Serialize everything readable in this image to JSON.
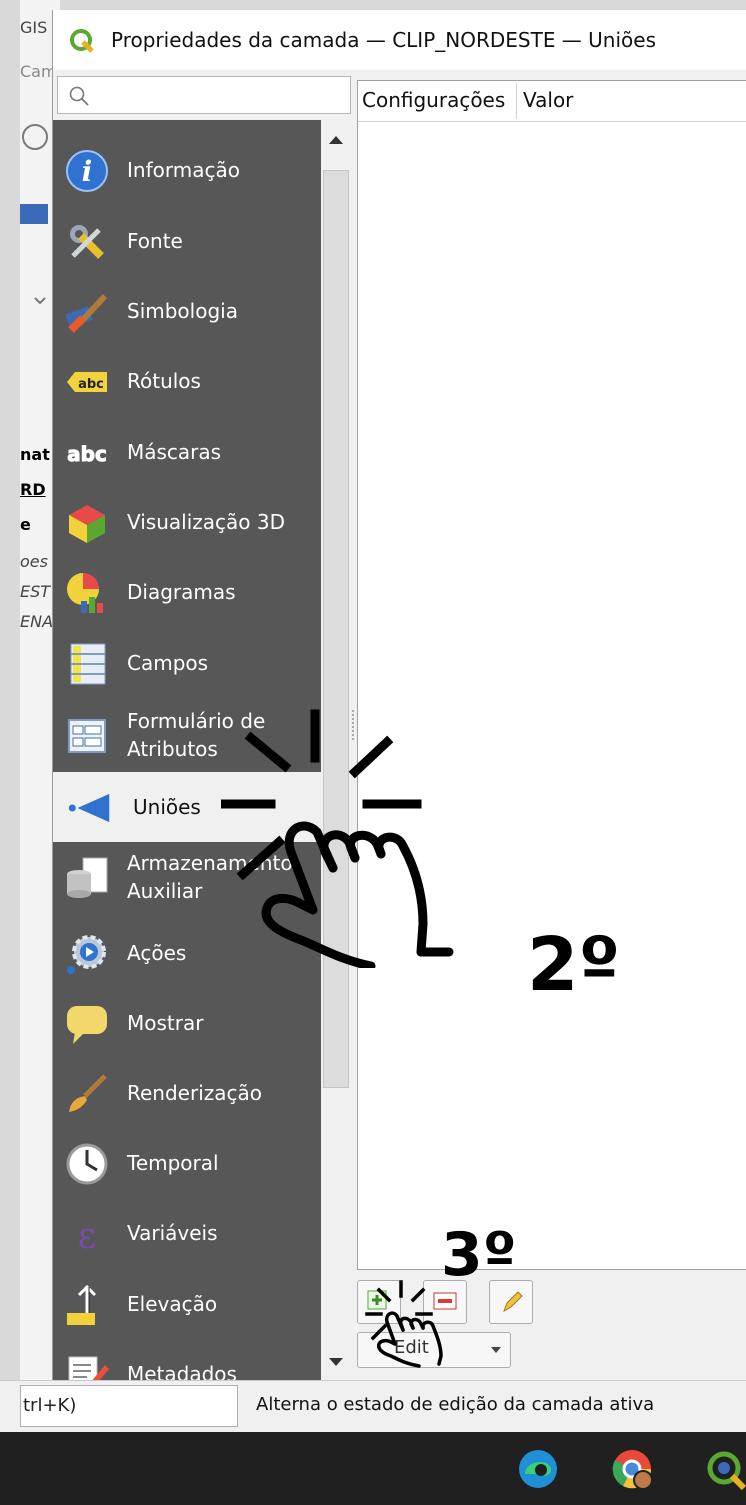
{
  "background_window": {
    "fragments": [
      "GIS",
      "Cam",
      "nat",
      "RD",
      "e",
      "oes",
      "EST",
      "ENA"
    ]
  },
  "dialog": {
    "title": "Propriedades da camada — CLIP_NORDESTE — Uniões",
    "search_placeholder": ""
  },
  "sidebar": {
    "items": [
      {
        "label": "Informação",
        "icon": "info-icon"
      },
      {
        "label": "Fonte",
        "icon": "source-tools-icon"
      },
      {
        "label": "Simbologia",
        "icon": "symbology-brush-icon"
      },
      {
        "label": "Rótulos",
        "icon": "labels-abc-icon"
      },
      {
        "label": "Máscaras",
        "icon": "masks-abc-icon"
      },
      {
        "label": "Visualização 3D",
        "icon": "cube-3d-icon"
      },
      {
        "label": "Diagramas",
        "icon": "diagrams-icon"
      },
      {
        "label": "Campos",
        "icon": "fields-icon"
      },
      {
        "label": "Formulário de\nAtributos",
        "icon": "attribute-form-icon"
      },
      {
        "label": "Uniões",
        "icon": "joins-icon",
        "selected": true
      },
      {
        "label": "Armazenamento\nAuxiliar",
        "icon": "auxiliary-storage-icon"
      },
      {
        "label": "Ações",
        "icon": "actions-gear-icon"
      },
      {
        "label": "Mostrar",
        "icon": "display-speech-icon"
      },
      {
        "label": "Renderização",
        "icon": "rendering-brush-icon"
      },
      {
        "label": "Temporal",
        "icon": "clock-icon"
      },
      {
        "label": "Variáveis",
        "icon": "epsilon-icon"
      },
      {
        "label": "Elevação",
        "icon": "elevation-icon"
      },
      {
        "label": "Metadados",
        "icon": "metadata-icon"
      }
    ]
  },
  "table": {
    "headers": [
      "Configurações",
      "Valor"
    ]
  },
  "toolbar": {
    "add_join": "add-join-icon",
    "remove_join": "remove-join-icon",
    "edit_join": "pencil-icon",
    "edit_combo_value": "Edit"
  },
  "status": {
    "shortcut": "trl+K)",
    "message": "Alterna o estado de edição da camada ativa"
  },
  "annotations": {
    "step2": "2º",
    "step3": "3º"
  },
  "colors": {
    "sidebar_bg": "#575757",
    "selected_bg": "#f0f0f0",
    "taskbar_bg": "#202020"
  }
}
